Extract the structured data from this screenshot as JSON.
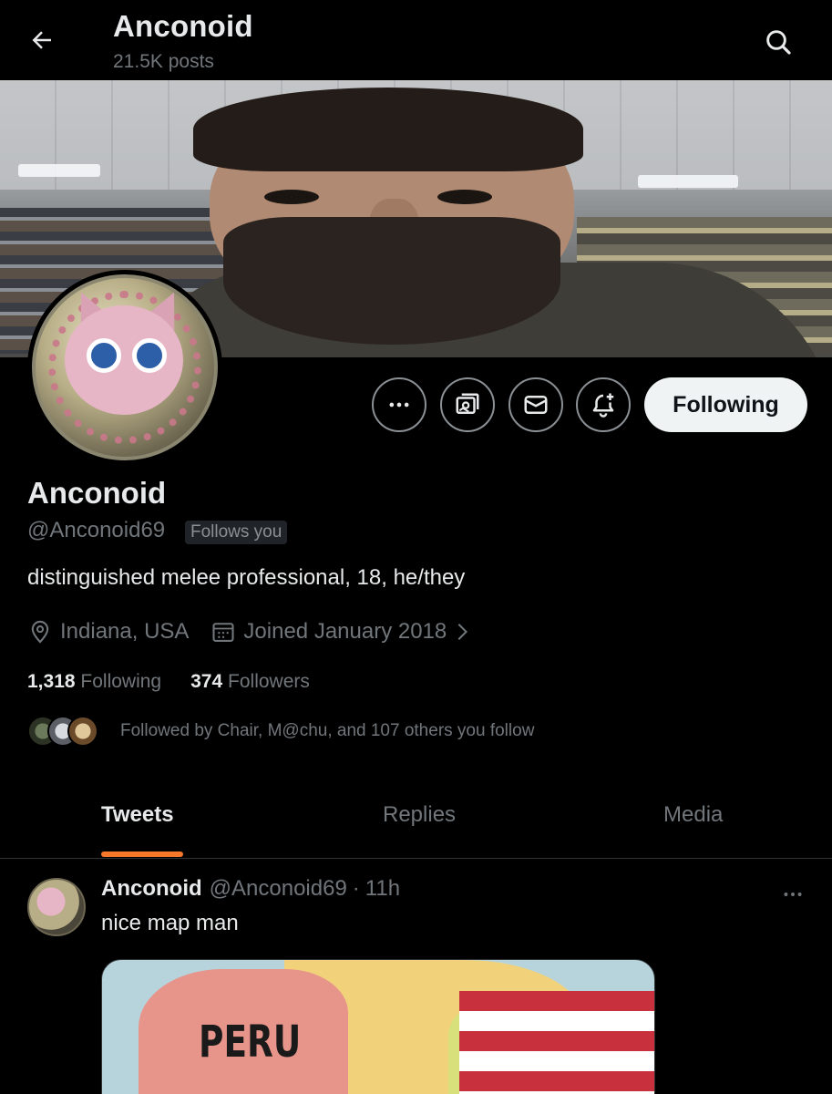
{
  "header": {
    "title": "Anconoid",
    "post_count": "21.5K posts",
    "back_icon": "arrow-left-icon",
    "search_icon": "search-icon"
  },
  "profile": {
    "display_name": "Anconoid",
    "handle": "@Anconoid69",
    "follows_you_badge": "Follows you",
    "bio": "distinguished melee professional, 18, he/they",
    "location": "Indiana, USA",
    "joined": "Joined January 2018",
    "following_count": "1,318",
    "following_label": "Following",
    "followers_count": "374",
    "followers_label": "Followers",
    "followed_by_text": "Followed by Chair, M@chu, and 107 others you follow"
  },
  "actions": {
    "more_icon": "more-horizontal-icon",
    "subscribe_icon": "subscriptions-icon",
    "message_icon": "mail-icon",
    "notify_icon": "bell-plus-icon",
    "follow_button_label": "Following"
  },
  "tabs": [
    {
      "label": "Tweets",
      "active": true
    },
    {
      "label": "Replies",
      "active": false
    },
    {
      "label": "Media",
      "active": false
    }
  ],
  "tweet": {
    "author_name": "Anconoid",
    "author_handle": "@Anconoid69",
    "separator": "·",
    "time": "11h",
    "text": "nice map man",
    "media_label": "PERU"
  },
  "colors": {
    "background": "#000000",
    "text_primary": "#e7e9ea",
    "text_secondary": "#71767b",
    "tab_accent": "#f4772a",
    "follow_button_bg": "#eff3f4"
  }
}
